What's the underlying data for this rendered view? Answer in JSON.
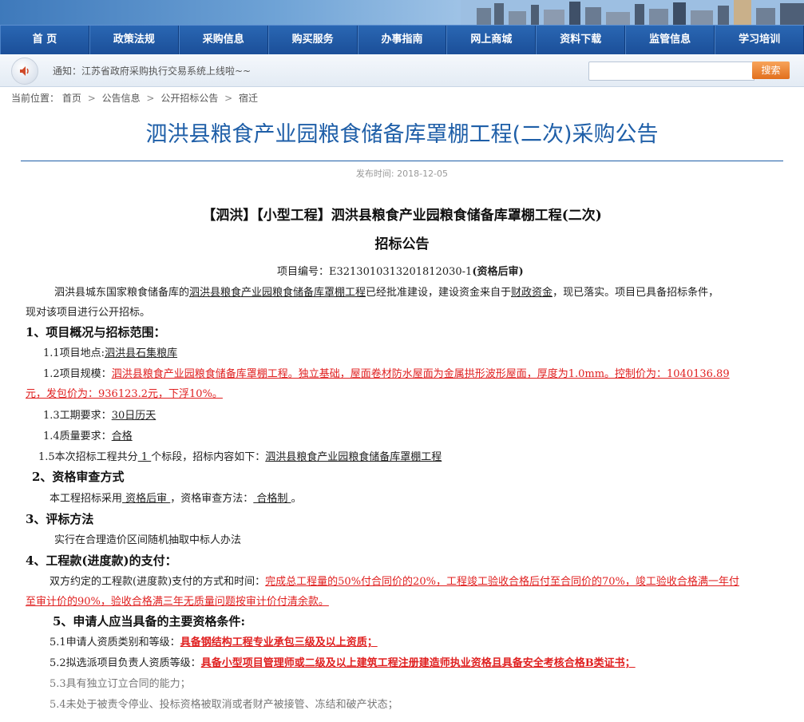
{
  "nav": {
    "items": [
      "首 页",
      "政策法规",
      "采购信息",
      "购买服务",
      "办事指南",
      "网上商城",
      "资料下载",
      "监管信息",
      "学习培训"
    ]
  },
  "notice": {
    "text": "通知：江苏省政府采购执行交易系统上线啦~~"
  },
  "search": {
    "placeholder": "",
    "button": "搜索"
  },
  "breadcrumb": {
    "label": "当前位置：",
    "items": [
      "首页",
      "公告信息",
      "公开招标公告",
      "宿迁"
    ],
    "sep": ">"
  },
  "article": {
    "title": "泗洪县粮食产业园粮食储备库罩棚工程(二次)采购公告",
    "publish_label": "发布时间: 2018-12-05",
    "heading1": "【泗洪】【小型工程】泗洪县粮食产业园粮食储备库罩棚工程(二次)",
    "heading2": "招标公告",
    "project_no_label": "项目编号：E3213010313201812030-1",
    "project_no_suffix": "(资格后审)",
    "intro_1": "泗洪县城东国家粮食储备库的",
    "intro_link": "泗洪县粮食产业园粮食储备库罩棚工程",
    "intro_2": "已经批准建设，建设资金来自于",
    "intro_fund": "财政资金",
    "intro_3": "，现已落实。项目已具备招标条件，",
    "intro_4": "现对该项目进行公开招标。",
    "s1": "1、项目概况与招标范围：",
    "s1_1_label": "1.1项目地点:",
    "s1_1_value": "泗洪县石集粮库",
    "s1_2_label": "1.2项目规模：",
    "s1_2_value_a": "泗洪县粮食产业园粮食储备库罩棚工程。独立基础，屋面卷材防水屋面为金属拱形波形屋面，厚度为1.0mm。控制价为：1040136.89",
    "s1_2_value_b": "元，发包价为：936123.2元，下浮10%。",
    "s1_3_label": "1.3工期要求：",
    "s1_3_value": "30日历天",
    "s1_4_label": "1.4质量要求：",
    "s1_4_value": "合格",
    "s1_5_a": "1.5本次招标工程共分",
    "s1_5_count": " 1 ",
    "s1_5_b": "个标段，招标内容如下：",
    "s1_5_value": "泗洪县粮食产业园粮食储备库罩棚工程",
    "s2": "2、资格审查方式",
    "s2_a": "本工程招标采用",
    "s2_mode": " 资格后审 ",
    "s2_b": "，资格审查方法：",
    "s2_method": " 合格制 ",
    "s2_c": "。",
    "s3": "3、评标方法",
    "s3_text": "实行在合理造价区间随机抽取中标人办法",
    "s4": "4、工程款(进度款)的支付：",
    "s4_label": "双方约定的工程款(进度款)支付的方式和时间：",
    "s4_value_a": "完成总工程量的50%付合同价的20%，工程竣工验收合格后付至合同价的70%，竣工验收合格满一年付",
    "s4_value_b": "至审计价的90%，验收合格满三年无质量问题按审计价付清余款。",
    "s5": "5、申请人应当具备的主要资格条件:",
    "s5_1_label": "5.1申请人资质类别和等级：",
    "s5_1_value": "具备钢结构工程专业承包三级及以上资质；",
    "s5_2_label": "5.2拟选派项目负责人资质等级：",
    "s5_2_value": "具备小型项目管理师或二级及以上建筑工程注册建造师执业资格且具备安全考核合格B类证书；",
    "s5_3": "5.3具有独立订立合同的能力；",
    "s5_4": "5.4未处于被责令停业、投标资格被取消或者财产被接管、冻结和破产状态；"
  }
}
